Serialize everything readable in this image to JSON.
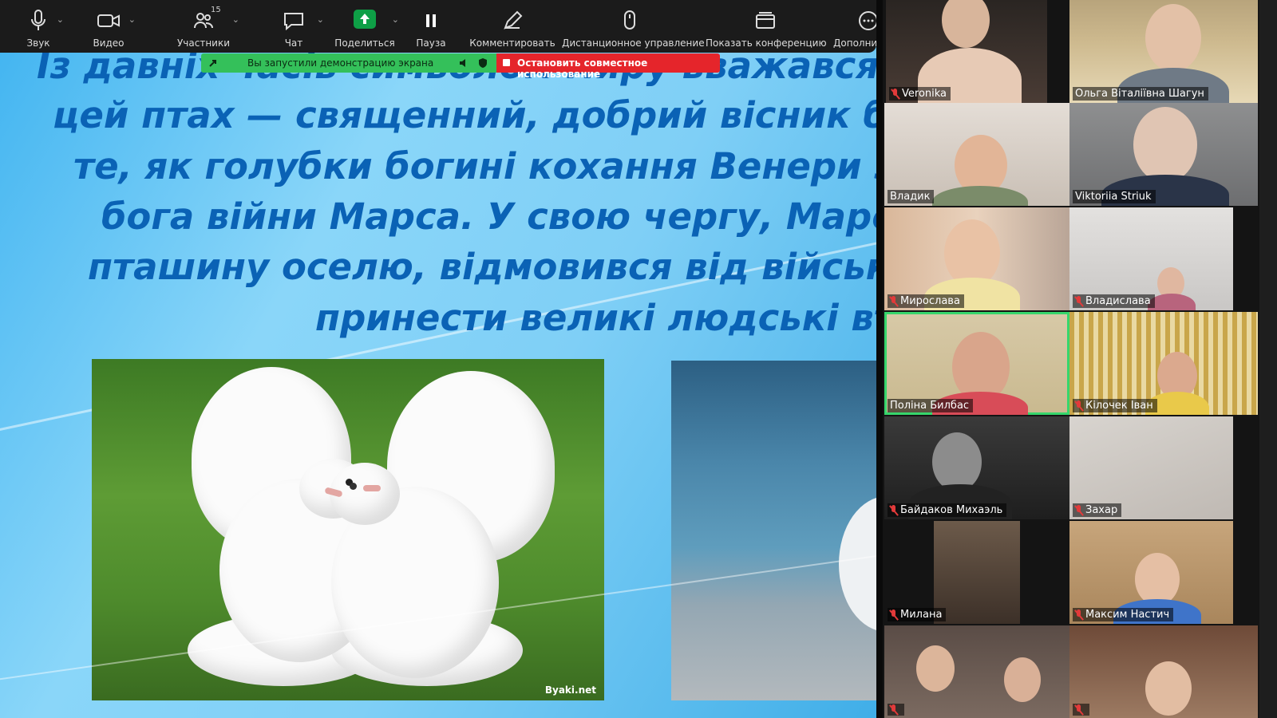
{
  "toolbar": {
    "items": [
      {
        "label": "Звук",
        "icon": "microphone-icon"
      },
      {
        "label": "Видео",
        "icon": "video-camera-icon"
      },
      {
        "label": "Участники",
        "icon": "participants-icon",
        "count": "15"
      },
      {
        "label": "Чат",
        "icon": "chat-icon"
      },
      {
        "label": "Поделиться",
        "icon": "share-screen-icon"
      },
      {
        "label": "Пауза",
        "icon": "pause-icon"
      },
      {
        "label": "Комментировать",
        "icon": "annotate-pencil-icon"
      },
      {
        "label": "Дистанционное управление",
        "icon": "mouse-icon"
      },
      {
        "label": "Показать конференцию",
        "icon": "show-meeting-icon"
      },
      {
        "label": "Дополни",
        "icon": "more-icon"
      }
    ],
    "share_status": "Вы запустили демонстрацию экрана",
    "stop_share": "Остановить совместное использование",
    "share_color": "#0e9f46",
    "stop_color": "#e5252b"
  },
  "slide": {
    "lines": [
      "Із давніх часів символом миру вважався гол",
      "цей птах — священний, добрий вісник богів",
      "те, як голубки богині кохання Венери звил",
      "бога війни Марса. У свою чергу, Марс, що",
      "пташину оселю, відмовився від військови",
      "принести великі людські втр"
    ],
    "text_color": "#0a62b5",
    "photo_watermark": "Byaki.net"
  },
  "participants": [
    {
      "name": "Veronika",
      "muted": true
    },
    {
      "name": "Ольга Віталіївна Шагун",
      "muted": false
    },
    {
      "name": "Владик",
      "muted": false
    },
    {
      "name": "Viktoriia Striuk",
      "muted": false
    },
    {
      "name": "Мирослава",
      "muted": true
    },
    {
      "name": "Владислава",
      "muted": true
    },
    {
      "name": "Поліна Билбас",
      "muted": false,
      "active": true
    },
    {
      "name": "Кілочек Іван",
      "muted": true
    },
    {
      "name": "Байдаков Михаэль",
      "muted": true
    },
    {
      "name": "Захар",
      "muted": true
    },
    {
      "name": "Милана",
      "muted": true
    },
    {
      "name": "Максим Настич",
      "muted": true
    },
    {
      "name": "",
      "muted": true
    },
    {
      "name": "",
      "muted": true
    }
  ],
  "active_speaker_color": "#36d66c"
}
